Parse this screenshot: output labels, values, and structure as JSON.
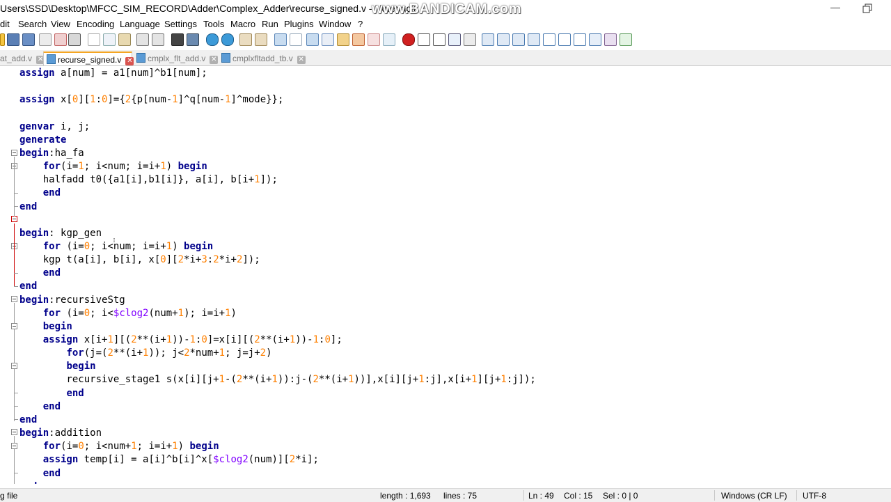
{
  "window": {
    "title": "Users\\SSD\\Desktop\\MFCC_SIM_RECORD\\Adder\\Complex_Adder\\recurse_signed.v - Notepad+",
    "watermark": "www.BANDICAM.com"
  },
  "menu": [
    "Edit",
    "Search",
    "View",
    "Encoding",
    "Language",
    "Settings",
    "Tools",
    "Macro",
    "Run",
    "Plugins",
    "Window",
    "?"
  ],
  "menu_visible_text": [
    "dit",
    "Search",
    "View",
    "Encoding",
    "Language",
    "Settings",
    "Tools",
    "Macro",
    "Run",
    "Plugins",
    "Window",
    "?"
  ],
  "tabs": [
    {
      "label": "at_add.v",
      "active": false
    },
    {
      "label": "recurse_signed.v",
      "active": true
    },
    {
      "label": "cmplx_flt_add.v",
      "active": false
    },
    {
      "label": "cmplxfltadd_tb.v",
      "active": false
    }
  ],
  "code_lines": [
    "assign a[num] = a1[num]^b1[num];",
    "",
    "assign x[0][1:0]={2{p[num-1]^q[num-1]^mode}};",
    "",
    "genvar i, j;",
    "generate",
    "begin:ha_fa",
    "    for(i=1; i<num; i=i+1) begin",
    "    halfadd t0({a1[i],b1[i]}, a[i], b[i+1]);",
    "    end",
    "end",
    "",
    "begin: kgp_gen",
    "    for (i=0; i<num; i=i+1) begin",
    "    kgp t(a[i], b[i], x[0][2*i+3:2*i+2]);",
    "    end",
    "end",
    "begin:recursiveStg",
    "    for (i=0; i<$clog2(num+1); i=i+1)",
    "    begin",
    "    assign x[i+1][(2**(i+1))-1:0]=x[i][(2**(i+1))-1:0];",
    "        for(j=(2**(i+1)); j<2*num+1; j=j+2)",
    "        begin",
    "        recursive_stage1 s(x[i][j+1-(2**(i+1)):j-(2**(i+1))],x[i][j+1:j],x[i+1][j+1:j]);",
    "        end",
    "    end",
    "end",
    "begin:addition",
    "    for(i=0; i<num+1; i=i+1) begin",
    "    assign temp[i] = a[i]^b[i]^x[$clog2(num)][2*i];",
    "    end",
    "end"
  ],
  "status": {
    "file_type": "g file",
    "length": "length : 1,693",
    "lines": "lines : 75",
    "ln": "Ln : 49",
    "col": "Col : 15",
    "sel": "Sel : 0 | 0",
    "eol": "Windows (CR LF)",
    "encoding": "UTF-8"
  },
  "colors": {
    "keyword": "#00008b",
    "number": "#ff8000",
    "system_task": "#8000ff",
    "active_tab_accent": "#f5a623"
  }
}
